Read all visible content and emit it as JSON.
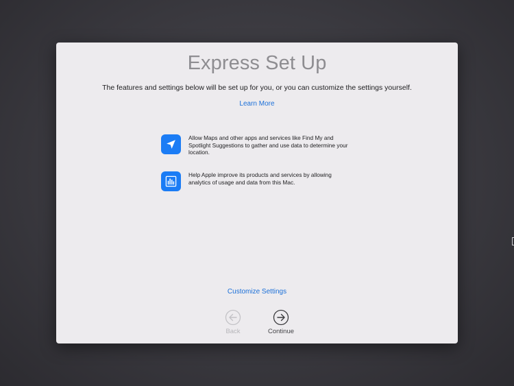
{
  "window": {
    "title": "Express Set Up",
    "subtitle": "The features and settings below will be set up for you, or you can customize the settings yourself.",
    "learn_more": "Learn More"
  },
  "features": [
    {
      "icon": "location-arrow-icon",
      "text": "Allow Maps and other apps and services like Find My and Spotlight Suggestions to gather and use data to determine your location."
    },
    {
      "icon": "analytics-chart-icon",
      "text": "Help Apple improve its products and services by allowing analytics of usage and data from this Mac."
    }
  ],
  "customize_settings": "Customize Settings",
  "navigation": {
    "back_label": "Back",
    "back_enabled": false,
    "continue_label": "Continue",
    "continue_enabled": true
  },
  "colors": {
    "accent": "#1a6fd8",
    "icon_background": "#1b7cf5",
    "panel_background": "#edebee",
    "title_color": "#8e8d91"
  }
}
